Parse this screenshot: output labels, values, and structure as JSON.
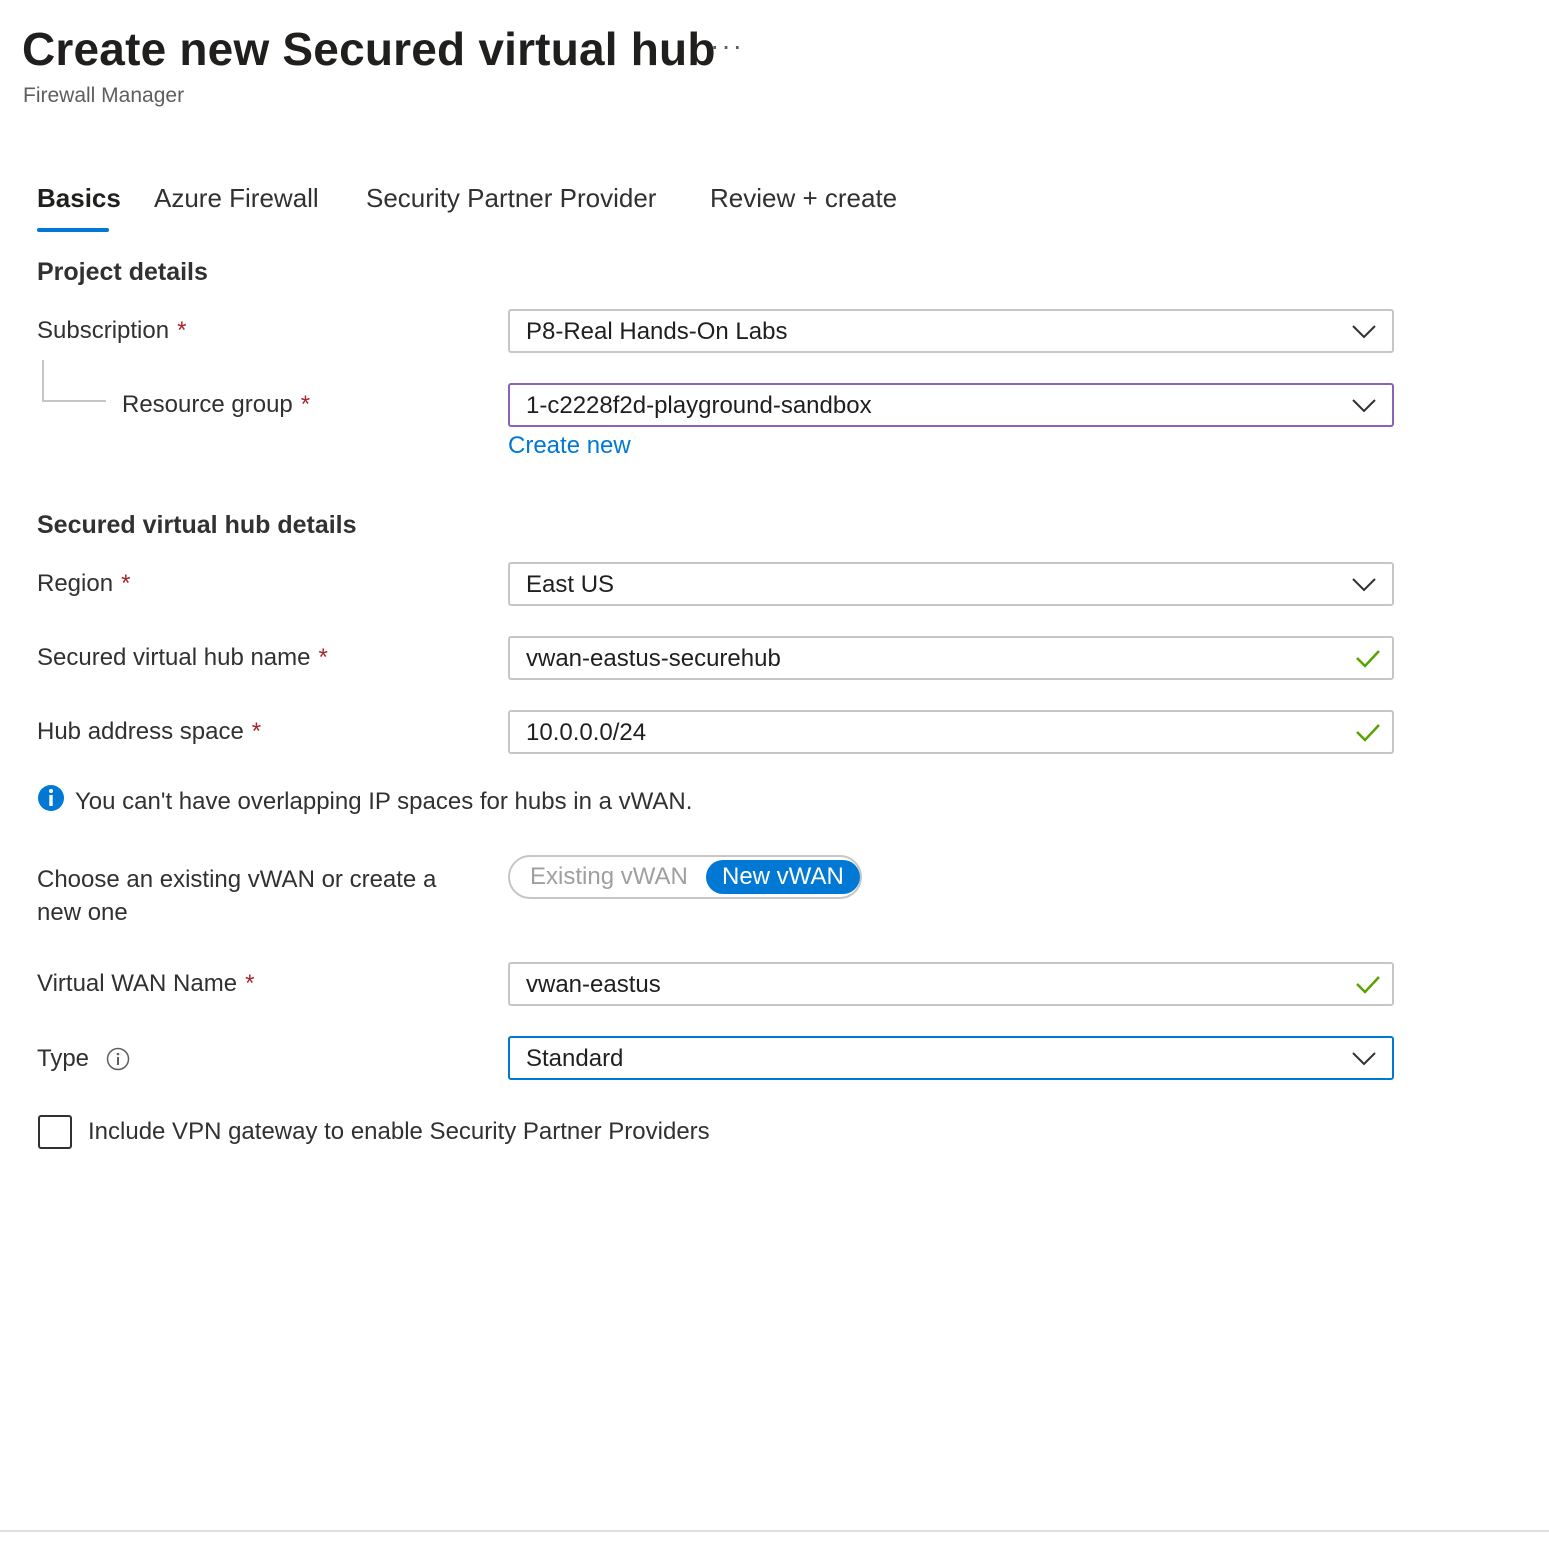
{
  "header": {
    "title": "Create new Secured virtual hub",
    "more": "···",
    "subtitle": "Firewall Manager"
  },
  "tabs": [
    {
      "label": "Basics",
      "active": true
    },
    {
      "label": "Azure Firewall",
      "active": false
    },
    {
      "label": "Security Partner Provider",
      "active": false
    },
    {
      "label": "Review + create",
      "active": false
    }
  ],
  "project": {
    "heading": "Project details",
    "subscription": {
      "label": "Subscription",
      "required": "*",
      "value": "P8-Real Hands-On Labs"
    },
    "resource_group": {
      "label": "Resource group",
      "required": "*",
      "value": "1-c2228f2d-playground-sandbox",
      "create_new": "Create new"
    }
  },
  "hub": {
    "heading": "Secured virtual hub details",
    "region": {
      "label": "Region",
      "required": "*",
      "value": "East US"
    },
    "name": {
      "label": "Secured virtual hub name",
      "required": "*",
      "value": "vwan-eastus-securehub"
    },
    "address": {
      "label": "Hub address space",
      "required": "*",
      "value": "10.0.0.0/24"
    },
    "info": "You can't have overlapping IP spaces for hubs in a vWAN.",
    "vwan_choice": {
      "label_line1": "Choose an existing vWAN or create a",
      "label_line2": "new one",
      "option_existing": "Existing vWAN",
      "option_new": "New vWAN",
      "selected": "New vWAN"
    },
    "vwan_name": {
      "label": "Virtual WAN Name",
      "required": "*",
      "value": "vwan-eastus"
    },
    "type": {
      "label": "Type",
      "value": "Standard"
    },
    "vpn_gateway": {
      "label": "Include VPN gateway to enable Security Partner Providers",
      "checked": false
    }
  },
  "colors": {
    "accent": "#0078d4",
    "required": "#a4262c",
    "valid": "#57a300",
    "focus_purple": "#8764b8"
  },
  "icons": {
    "chevron": "chevron-down-icon",
    "valid": "checkmark-icon",
    "info": "info-icon"
  }
}
